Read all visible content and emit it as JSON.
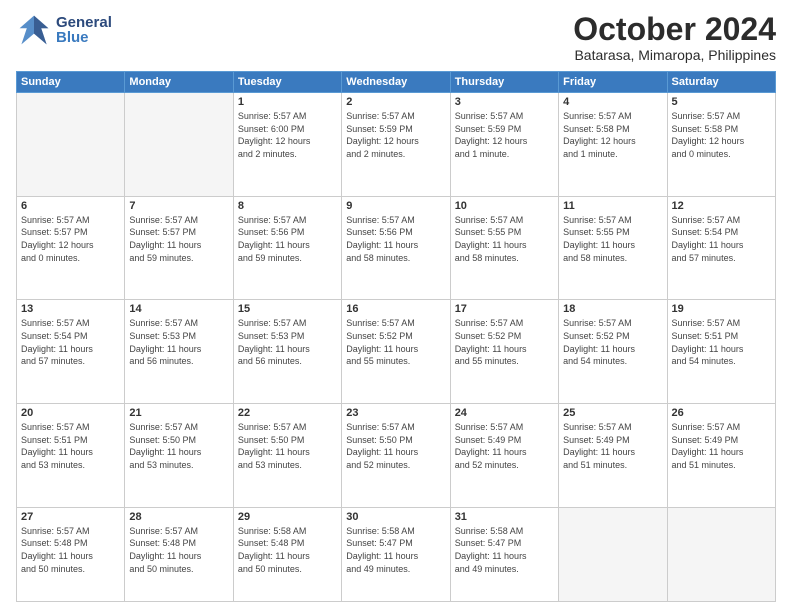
{
  "header": {
    "logo_general": "General",
    "logo_blue": "Blue",
    "month_title": "October 2024",
    "subtitle": "Batarasa, Mimaropa, Philippines"
  },
  "weekdays": [
    "Sunday",
    "Monday",
    "Tuesday",
    "Wednesday",
    "Thursday",
    "Friday",
    "Saturday"
  ],
  "weeks": [
    [
      {
        "day": "",
        "info": ""
      },
      {
        "day": "",
        "info": ""
      },
      {
        "day": "1",
        "info": "Sunrise: 5:57 AM\nSunset: 6:00 PM\nDaylight: 12 hours\nand 2 minutes."
      },
      {
        "day": "2",
        "info": "Sunrise: 5:57 AM\nSunset: 5:59 PM\nDaylight: 12 hours\nand 2 minutes."
      },
      {
        "day": "3",
        "info": "Sunrise: 5:57 AM\nSunset: 5:59 PM\nDaylight: 12 hours\nand 1 minute."
      },
      {
        "day": "4",
        "info": "Sunrise: 5:57 AM\nSunset: 5:58 PM\nDaylight: 12 hours\nand 1 minute."
      },
      {
        "day": "5",
        "info": "Sunrise: 5:57 AM\nSunset: 5:58 PM\nDaylight: 12 hours\nand 0 minutes."
      }
    ],
    [
      {
        "day": "6",
        "info": "Sunrise: 5:57 AM\nSunset: 5:57 PM\nDaylight: 12 hours\nand 0 minutes."
      },
      {
        "day": "7",
        "info": "Sunrise: 5:57 AM\nSunset: 5:57 PM\nDaylight: 11 hours\nand 59 minutes."
      },
      {
        "day": "8",
        "info": "Sunrise: 5:57 AM\nSunset: 5:56 PM\nDaylight: 11 hours\nand 59 minutes."
      },
      {
        "day": "9",
        "info": "Sunrise: 5:57 AM\nSunset: 5:56 PM\nDaylight: 11 hours\nand 58 minutes."
      },
      {
        "day": "10",
        "info": "Sunrise: 5:57 AM\nSunset: 5:55 PM\nDaylight: 11 hours\nand 58 minutes."
      },
      {
        "day": "11",
        "info": "Sunrise: 5:57 AM\nSunset: 5:55 PM\nDaylight: 11 hours\nand 58 minutes."
      },
      {
        "day": "12",
        "info": "Sunrise: 5:57 AM\nSunset: 5:54 PM\nDaylight: 11 hours\nand 57 minutes."
      }
    ],
    [
      {
        "day": "13",
        "info": "Sunrise: 5:57 AM\nSunset: 5:54 PM\nDaylight: 11 hours\nand 57 minutes."
      },
      {
        "day": "14",
        "info": "Sunrise: 5:57 AM\nSunset: 5:53 PM\nDaylight: 11 hours\nand 56 minutes."
      },
      {
        "day": "15",
        "info": "Sunrise: 5:57 AM\nSunset: 5:53 PM\nDaylight: 11 hours\nand 56 minutes."
      },
      {
        "day": "16",
        "info": "Sunrise: 5:57 AM\nSunset: 5:52 PM\nDaylight: 11 hours\nand 55 minutes."
      },
      {
        "day": "17",
        "info": "Sunrise: 5:57 AM\nSunset: 5:52 PM\nDaylight: 11 hours\nand 55 minutes."
      },
      {
        "day": "18",
        "info": "Sunrise: 5:57 AM\nSunset: 5:52 PM\nDaylight: 11 hours\nand 54 minutes."
      },
      {
        "day": "19",
        "info": "Sunrise: 5:57 AM\nSunset: 5:51 PM\nDaylight: 11 hours\nand 54 minutes."
      }
    ],
    [
      {
        "day": "20",
        "info": "Sunrise: 5:57 AM\nSunset: 5:51 PM\nDaylight: 11 hours\nand 53 minutes."
      },
      {
        "day": "21",
        "info": "Sunrise: 5:57 AM\nSunset: 5:50 PM\nDaylight: 11 hours\nand 53 minutes."
      },
      {
        "day": "22",
        "info": "Sunrise: 5:57 AM\nSunset: 5:50 PM\nDaylight: 11 hours\nand 53 minutes."
      },
      {
        "day": "23",
        "info": "Sunrise: 5:57 AM\nSunset: 5:50 PM\nDaylight: 11 hours\nand 52 minutes."
      },
      {
        "day": "24",
        "info": "Sunrise: 5:57 AM\nSunset: 5:49 PM\nDaylight: 11 hours\nand 52 minutes."
      },
      {
        "day": "25",
        "info": "Sunrise: 5:57 AM\nSunset: 5:49 PM\nDaylight: 11 hours\nand 51 minutes."
      },
      {
        "day": "26",
        "info": "Sunrise: 5:57 AM\nSunset: 5:49 PM\nDaylight: 11 hours\nand 51 minutes."
      }
    ],
    [
      {
        "day": "27",
        "info": "Sunrise: 5:57 AM\nSunset: 5:48 PM\nDaylight: 11 hours\nand 50 minutes."
      },
      {
        "day": "28",
        "info": "Sunrise: 5:57 AM\nSunset: 5:48 PM\nDaylight: 11 hours\nand 50 minutes."
      },
      {
        "day": "29",
        "info": "Sunrise: 5:58 AM\nSunset: 5:48 PM\nDaylight: 11 hours\nand 50 minutes."
      },
      {
        "day": "30",
        "info": "Sunrise: 5:58 AM\nSunset: 5:47 PM\nDaylight: 11 hours\nand 49 minutes."
      },
      {
        "day": "31",
        "info": "Sunrise: 5:58 AM\nSunset: 5:47 PM\nDaylight: 11 hours\nand 49 minutes."
      },
      {
        "day": "",
        "info": ""
      },
      {
        "day": "",
        "info": ""
      }
    ]
  ]
}
